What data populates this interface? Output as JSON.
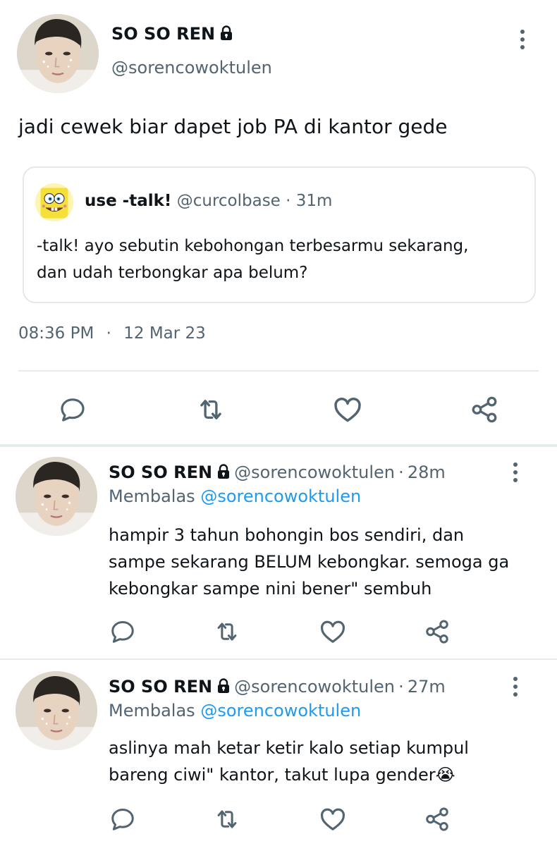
{
  "main_tweet": {
    "author_name": "SO SO REN",
    "author_handle": "@sorencowoktulen",
    "text": "jadi cewek biar dapet job PA di kantor gede",
    "quoted": {
      "author_name": "use -talk!",
      "author_handle": "@curcolbase",
      "separator": "·",
      "time_ago": "31m",
      "text_line1": "-talk! ayo sebutin kebohongan terbesarmu sekarang,",
      "text_line2": "dan udah terbongkar apa belum?"
    },
    "time": "08:36 PM",
    "dot": "·",
    "date": "12 Mar 23"
  },
  "replies": [
    {
      "author_name": "SO SO REN",
      "author_handle": "@sorencowoktulen",
      "separator": "·",
      "time_ago": "28m",
      "replying_label": "Membalas",
      "replying_handle": "@sorencowoktulen",
      "line1": "hampir 3 tahun bohongin bos sendiri, dan",
      "line2": "sampe sekarang BELUM kebongkar. semoga ga",
      "line3": "kebongkar sampe nini bener\" sembuh"
    },
    {
      "author_name": "SO SO REN",
      "author_handle": "@sorencowoktulen",
      "separator": "·",
      "time_ago": "27m",
      "replying_label": "Membalas",
      "replying_handle": "@sorencowoktulen",
      "line1": "aslinya mah ketar ketir kalo setiap kumpul",
      "line2": "bareng ciwi\" kantor, takut lupa gender",
      "emoji": "😭"
    }
  ],
  "icons": [
    "lock-icon",
    "more-icon",
    "reply-icon",
    "retweet-icon",
    "like-icon",
    "share-icon"
  ],
  "colors": {
    "text": "#0f1419",
    "muted": "#536471",
    "link": "#1d9bf0",
    "border": "#e6ebee"
  }
}
